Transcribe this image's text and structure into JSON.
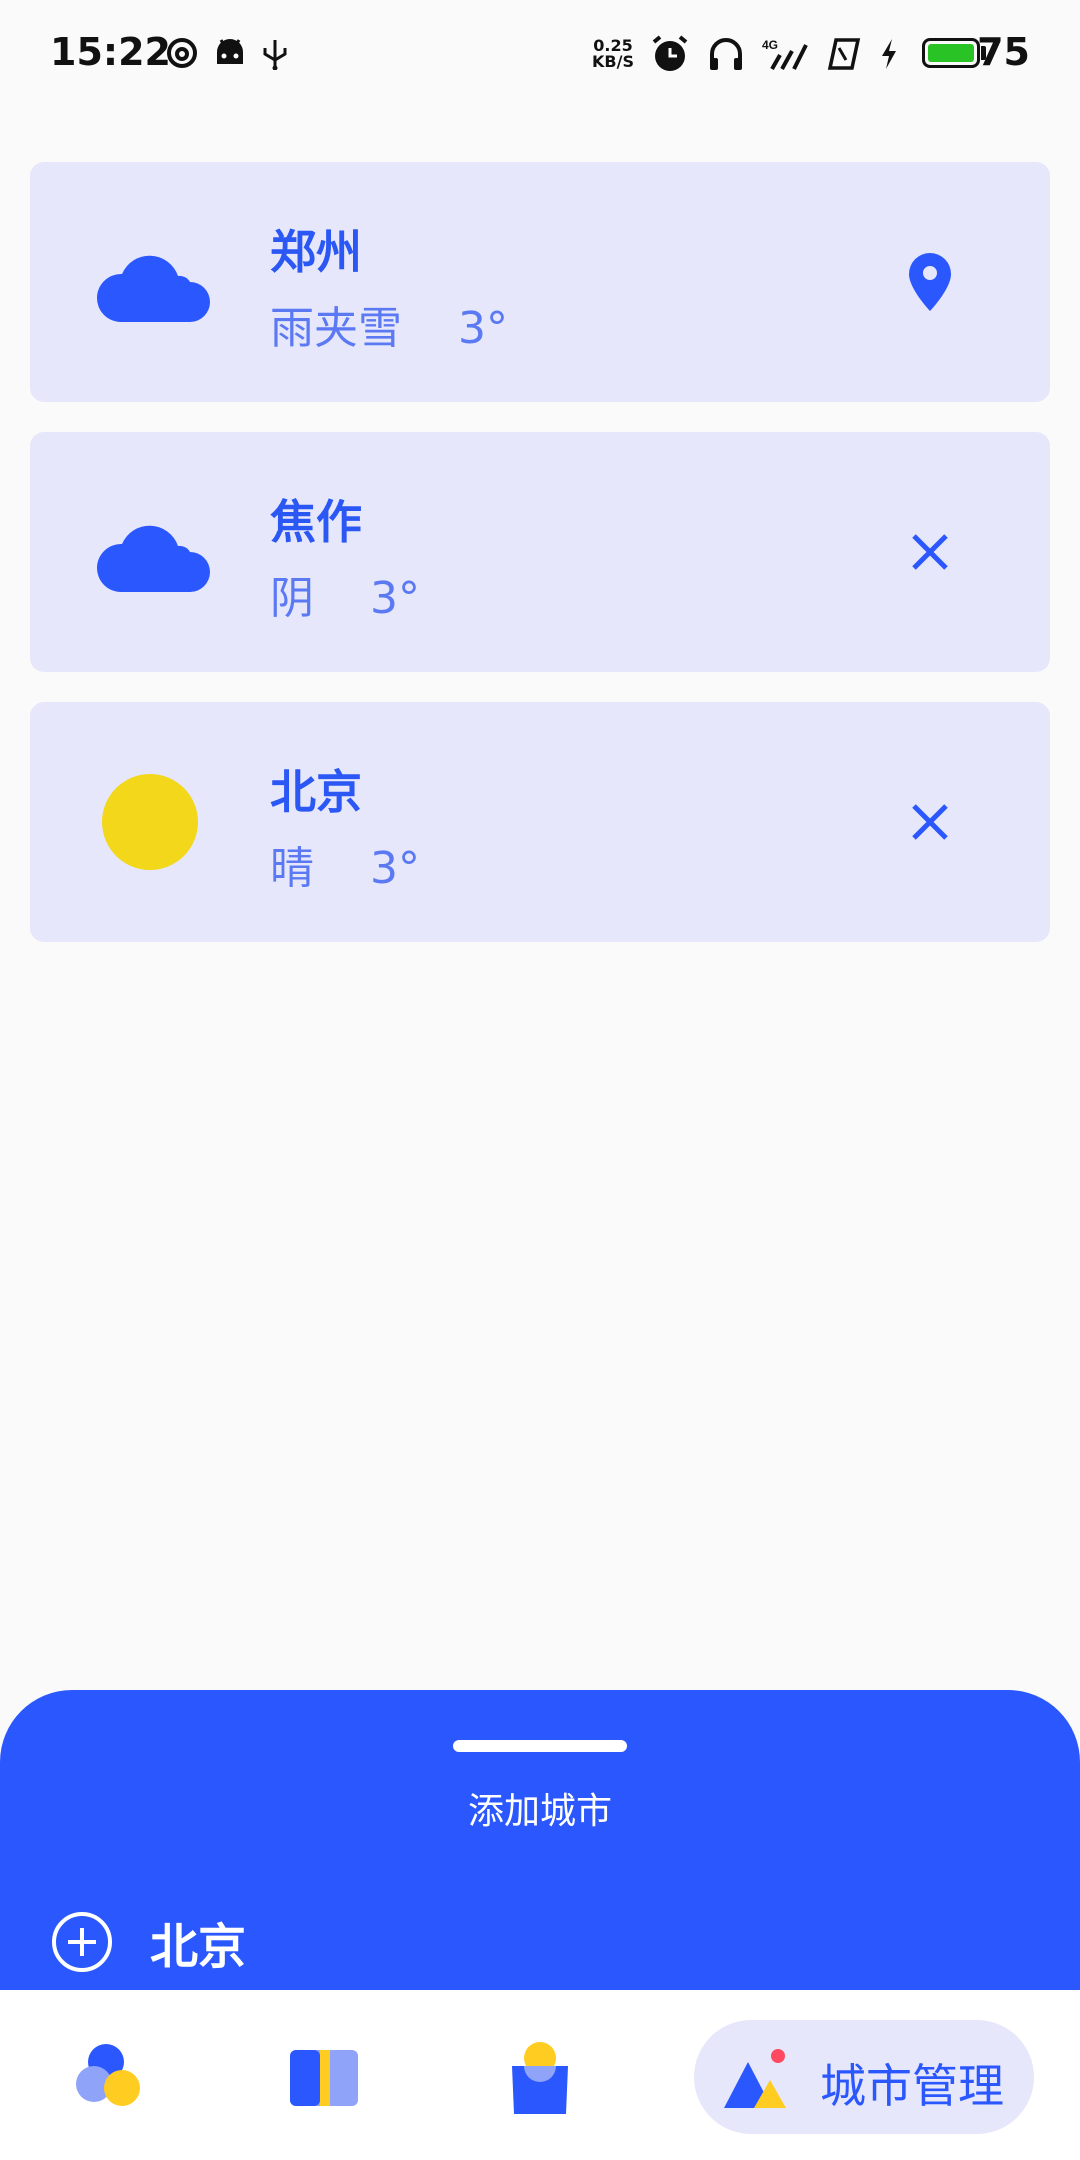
{
  "status_bar": {
    "time": "15:22",
    "net_speed_value": "0.25",
    "net_speed_unit": "KB/S",
    "battery_level": "75",
    "network": "4G"
  },
  "cities": [
    {
      "name": "郑州",
      "weather": "雨夹雪",
      "temp": "3°",
      "icon": "cloud-icon",
      "action": "location-pin-icon"
    },
    {
      "name": "焦作",
      "weather": "阴",
      "temp": "3°",
      "icon": "cloud-icon",
      "action": "close-icon"
    },
    {
      "name": "北京",
      "weather": "晴",
      "temp": "3°",
      "icon": "sun-icon",
      "action": "close-icon"
    }
  ],
  "sheet": {
    "title": "添加城市",
    "add_city": "北京"
  },
  "nav": {
    "active_label": "城市管理",
    "items": [
      "weather-tab-icon",
      "cards-tab-icon",
      "bag-tab-icon",
      "city-manage-tab-icon"
    ]
  },
  "colors": {
    "accent": "#2b57fe",
    "card_bg": "#e6e7fb",
    "sun": "#f2d71a",
    "nav_yellow": "#ffcc21"
  }
}
